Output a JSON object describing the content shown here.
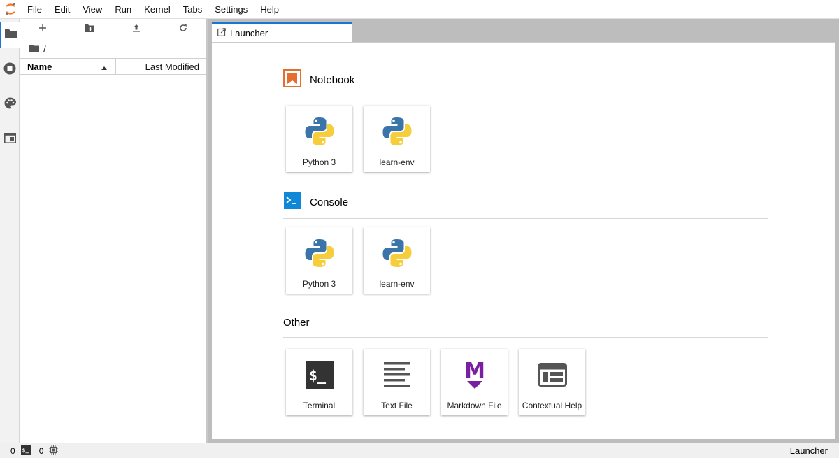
{
  "menu": [
    "File",
    "Edit",
    "View",
    "Run",
    "Kernel",
    "Tabs",
    "Settings",
    "Help"
  ],
  "activity_icons": [
    "folder-icon",
    "running-icon",
    "palette-icon",
    "tabs-icon"
  ],
  "filebrowser": {
    "breadcrumb": "/",
    "col_name": "Name",
    "col_modified": "Last Modified"
  },
  "tab": {
    "label": "Launcher"
  },
  "launcher": {
    "notebook": {
      "title": "Notebook",
      "items": [
        "Python 3",
        "learn-env"
      ]
    },
    "console": {
      "title": "Console",
      "items": [
        "Python 3",
        "learn-env"
      ]
    },
    "other": {
      "title": "Other",
      "items": [
        "Terminal",
        "Text File",
        "Markdown File",
        "Contextual Help"
      ]
    }
  },
  "status": {
    "terminals_count": "0",
    "kernels_count": "0",
    "right_label": "Launcher"
  },
  "colors": {
    "accent": "#1976d2",
    "notebook_orange": "#e46e2e",
    "console_blue": "#0f88d8",
    "markdown_purple": "#7b1fa2",
    "python_blue": "#3b74a8",
    "python_yellow": "#f6cd3a"
  }
}
